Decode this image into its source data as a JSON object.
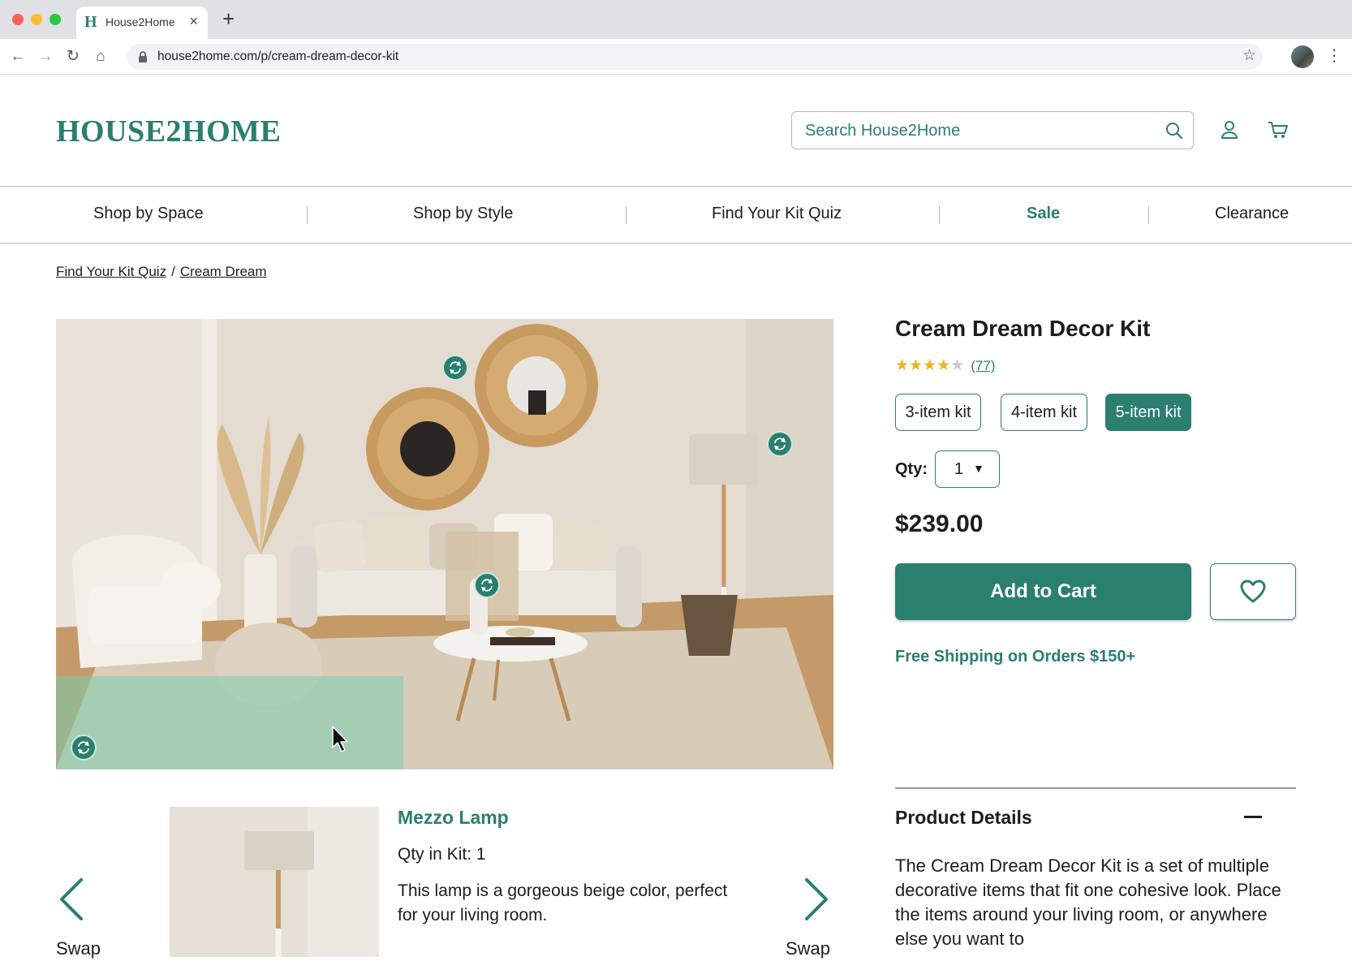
{
  "browser": {
    "tab_title": "House2Home",
    "tab_favicon": "H",
    "url": "house2home.com/p/cream-dream-decor-kit"
  },
  "header": {
    "logo": "HOUSE2HOME",
    "search_placeholder": "Search House2Home"
  },
  "nav": {
    "items": [
      "Shop by Space",
      "Shop by Style",
      "Find Your Kit Quiz",
      "Sale",
      "Clearance"
    ]
  },
  "breadcrumb": {
    "items": [
      "Find Your Kit Quiz",
      "Cream Dream"
    ],
    "separator": "/"
  },
  "product": {
    "title": "Cream Dream Decor Kit",
    "rating": 4,
    "rating_max": 5,
    "review_count": "(77)",
    "kit_options": [
      "3-item kit",
      "4-item kit",
      "5-item kit"
    ],
    "selected_kit": "5-item kit",
    "qty_label": "Qty:",
    "qty_value": "1",
    "price": "$239.00",
    "add_to_cart": "Add to Cart",
    "shipping": "Free Shipping on Orders $150+",
    "details_heading": "Product Details",
    "details_text": "The Cream Dream Decor Kit is a set of multiple decorative items that fit one cohesive look. Place the items around your living room, or anywhere else you want to"
  },
  "kit_item": {
    "name": "Mezzo Lamp",
    "qty": "Qty in Kit: 1",
    "description": "This lamp is a gorgeous beige color, perfect for your living room.",
    "swap_left": "Swap",
    "swap_right": "Swap"
  },
  "colors": {
    "brand": "#2a7f6f",
    "star": "#f0b41a",
    "rug_highlight": "#7acdaf"
  }
}
